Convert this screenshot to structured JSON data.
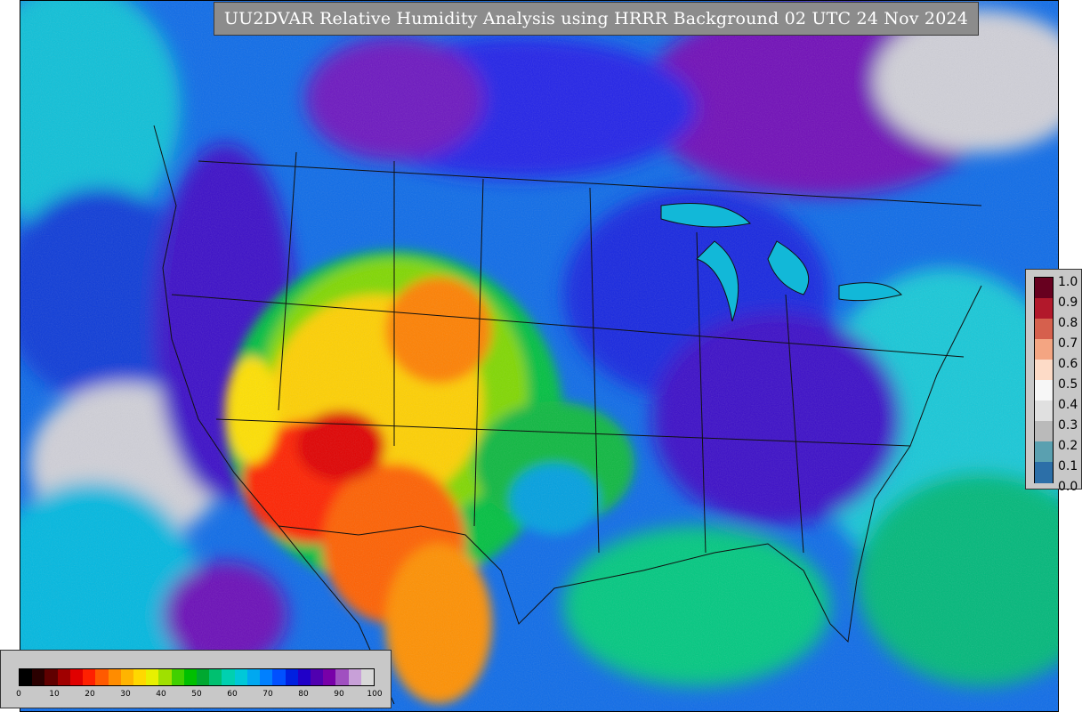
{
  "title": "UU2DVAR Relative Humidity Analysis using HRRR Background 02 UTC 24 Nov 2024",
  "rh_scale": {
    "ticks": [
      "0",
      "10",
      "20",
      "30",
      "40",
      "50",
      "60",
      "70",
      "80",
      "90",
      "100"
    ],
    "colors": [
      "#000000",
      "#2a0000",
      "#600000",
      "#a00000",
      "#e00000",
      "#ff2000",
      "#ff5a00",
      "#ff8c00",
      "#ffb400",
      "#ffd800",
      "#e8f000",
      "#a0e000",
      "#40d000",
      "#00c000",
      "#00a830",
      "#00c070",
      "#00d0b0",
      "#00c8d8",
      "#00a8f0",
      "#0080ff",
      "#0050ff",
      "#0020e0",
      "#2000c8",
      "#5000b0",
      "#7800a8",
      "#a050c0",
      "#c8a0d8",
      "#d8d8d8"
    ]
  },
  "obs_scale": {
    "ticks": [
      "1.0",
      "0.9",
      "0.8",
      "0.7",
      "0.6",
      "0.5",
      "0.4",
      "0.3",
      "0.2",
      "0.1",
      "0.0"
    ],
    "colors": [
      "#67001f",
      "#b2182b",
      "#d6604d",
      "#f4a582",
      "#fddbc7",
      "#f7f7f7",
      "#e0e0e0",
      "#bababa",
      "#5aa0b0",
      "#2c6fa8",
      "#08306b"
    ]
  }
}
